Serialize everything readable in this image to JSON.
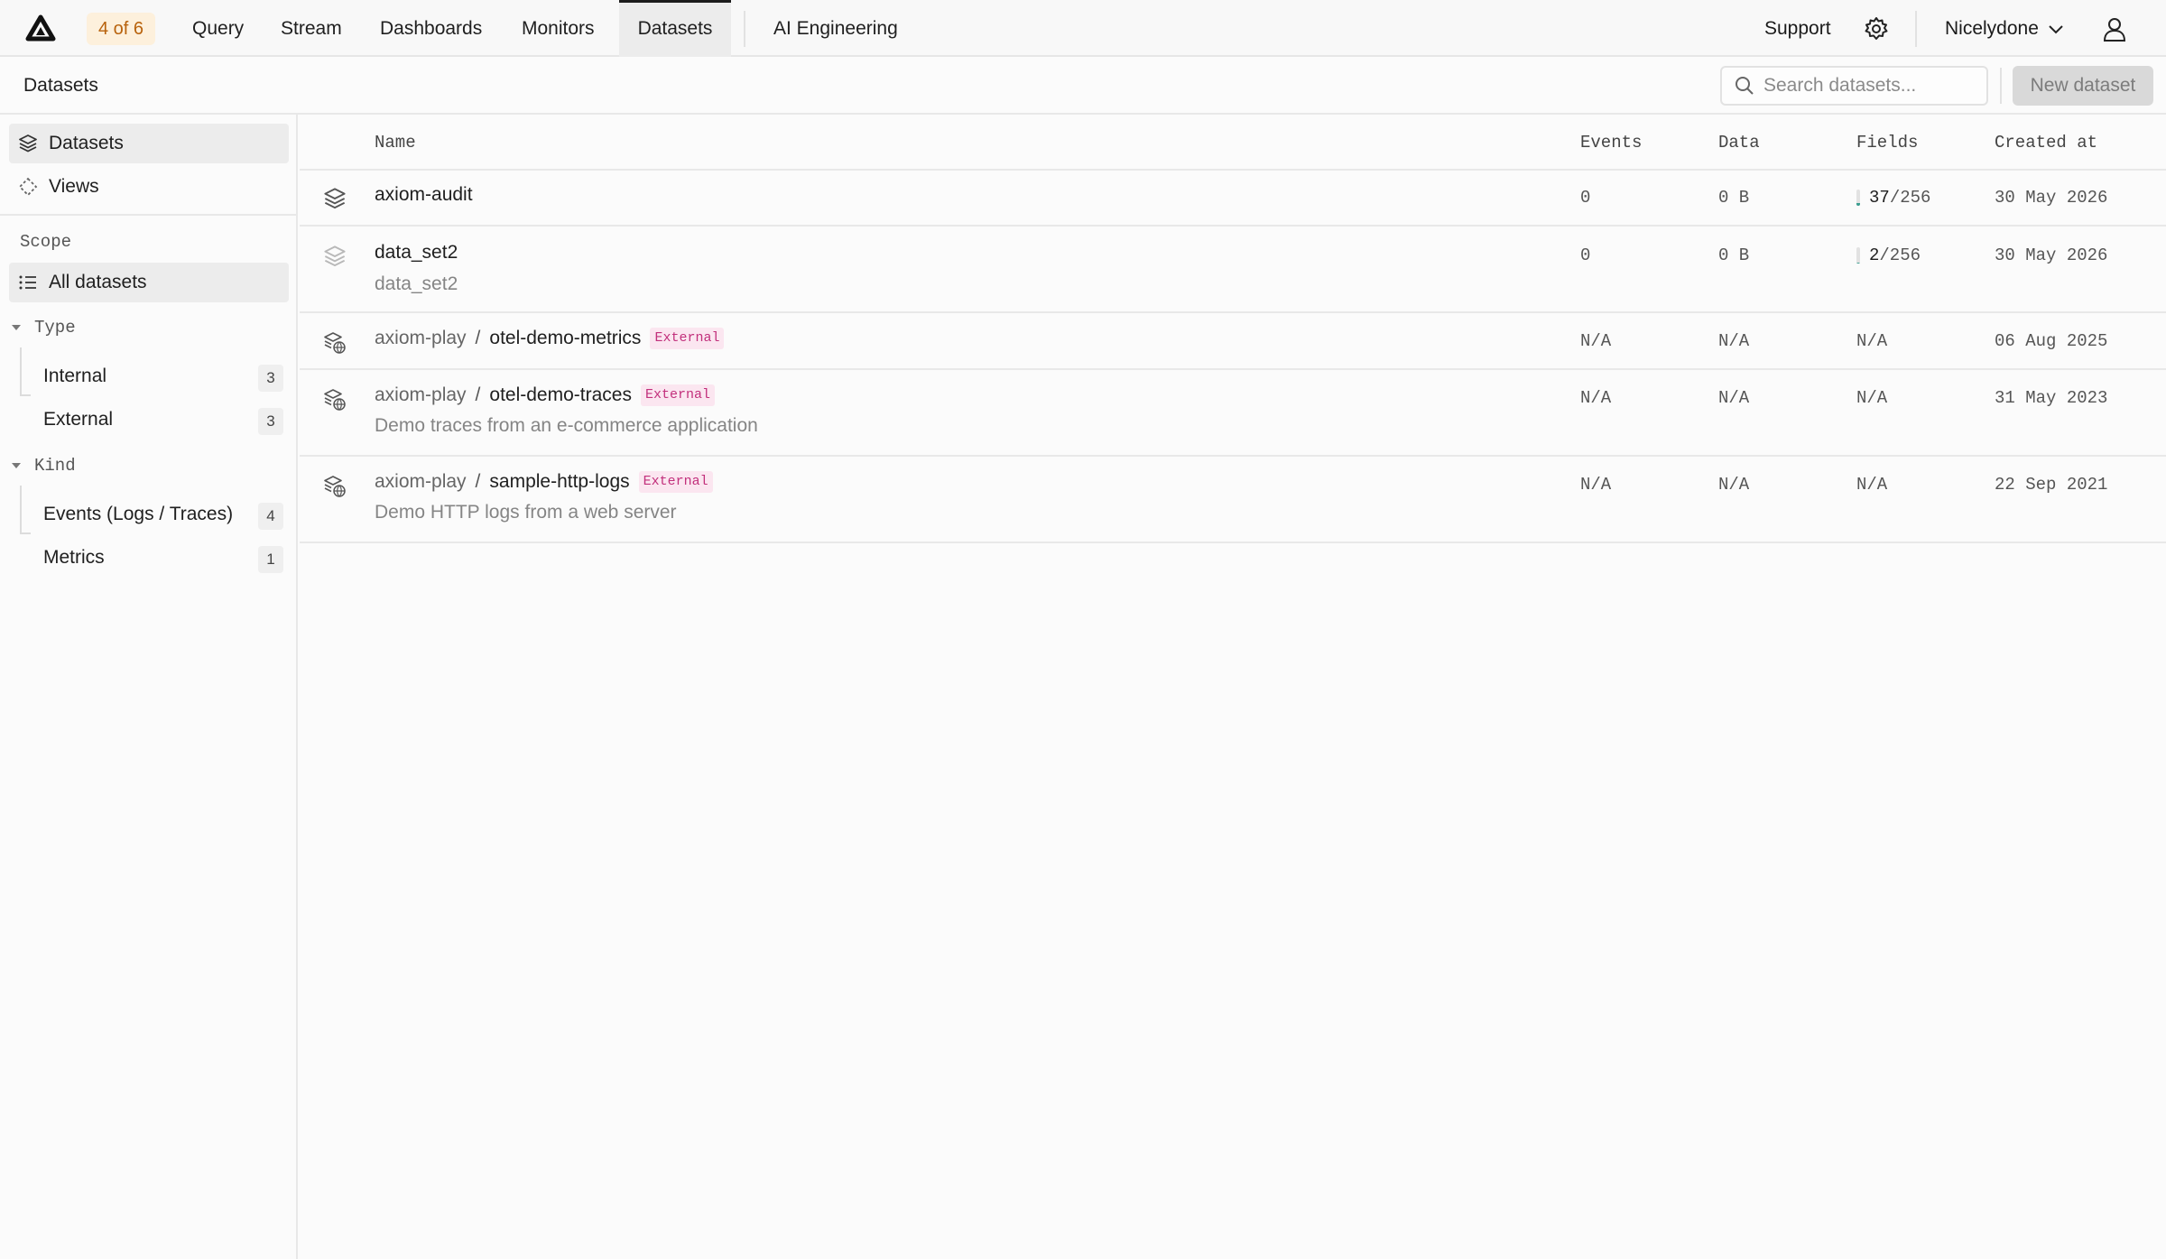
{
  "topnav": {
    "trial_badge": "4 of 6",
    "items": [
      "Query",
      "Stream",
      "Dashboards",
      "Monitors",
      "Datasets",
      "AI Engineering"
    ],
    "active_item": "Datasets",
    "support_label": "Support",
    "org_name": "Nicelydone"
  },
  "subheader": {
    "title": "Datasets",
    "search_placeholder": "Search datasets...",
    "new_button_label": "New dataset"
  },
  "sidebar": {
    "nav": [
      {
        "label": "Datasets",
        "icon": "layers-icon",
        "active": true
      },
      {
        "label": "Views",
        "icon": "dashed-diamond-icon",
        "active": false
      }
    ],
    "scope_label": "Scope",
    "all_datasets_label": "All datasets",
    "groups": [
      {
        "label": "Type",
        "items": [
          {
            "label": "Internal",
            "count": "3"
          },
          {
            "label": "External",
            "count": "3"
          }
        ]
      },
      {
        "label": "Kind",
        "items": [
          {
            "label": "Events (Logs / Traces)",
            "count": "4"
          },
          {
            "label": "Metrics",
            "count": "1"
          }
        ]
      }
    ]
  },
  "table": {
    "columns": {
      "name": "Name",
      "events": "Events",
      "data": "Data",
      "fields": "Fields",
      "created": "Created at"
    },
    "rows": [
      {
        "org": "",
        "name": "axiom-audit",
        "external": false,
        "description": "",
        "events": "0",
        "data": "0 B",
        "fields_used": "37",
        "fields_total": "/256",
        "fields_fraction": 0.145,
        "created": "30 May 2026",
        "icon": "layers-icon"
      },
      {
        "org": "",
        "name": "data_set2",
        "external": false,
        "description": "data_set2",
        "events": "0",
        "data": "0 B",
        "fields_used": "2",
        "fields_total": "/256",
        "fields_fraction": 0.008,
        "created": "30 May 2026",
        "icon": "layers-faded-icon"
      },
      {
        "org": "axiom-play",
        "name": "otel-demo-metrics",
        "external": true,
        "external_label": "External",
        "description": "",
        "events": "N/A",
        "data": "N/A",
        "fields": "N/A",
        "created": "06 Aug 2025",
        "icon": "external-dataset-icon"
      },
      {
        "org": "axiom-play",
        "name": "otel-demo-traces",
        "external": true,
        "external_label": "External",
        "description": "Demo traces from an e-commerce application",
        "events": "N/A",
        "data": "N/A",
        "fields": "N/A",
        "created": "31 May 2023",
        "icon": "external-dataset-icon"
      },
      {
        "org": "axiom-play",
        "name": "sample-http-logs",
        "external": true,
        "external_label": "External",
        "description": "Demo HTTP logs from a web server",
        "events": "N/A",
        "data": "N/A",
        "fields": "N/A",
        "created": "22 Sep 2021",
        "icon": "external-dataset-icon"
      }
    ]
  },
  "colors": {
    "accent_trial_bg": "#fdf0dc",
    "accent_trial_text": "#b8620c",
    "external_tag": "#c2307c",
    "field_bar": "#3a9d8f"
  }
}
